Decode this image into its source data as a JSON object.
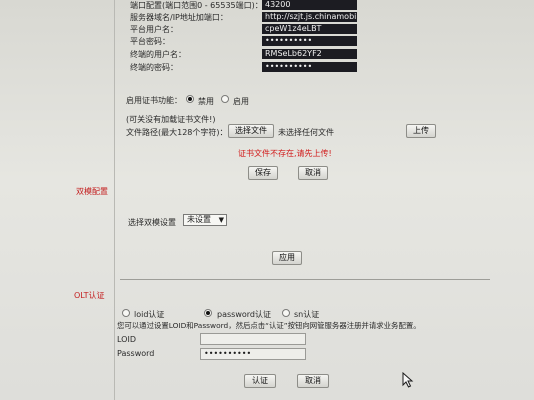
{
  "platform": {
    "rows": [
      {
        "label": "端口配置(端口范围0 - 65535端口)：",
        "value": "43200"
      },
      {
        "label": "服务器域名/IP地址加端口：",
        "value": "http://szjt.js.chinamobile."
      },
      {
        "label": "平台用户名：",
        "value": "cpeW1z4eLBT"
      },
      {
        "label": "平台密码：",
        "value": "••••••••••"
      },
      {
        "label": "终端的用户名：",
        "value": "RMSeLb62YF2"
      },
      {
        "label": "终端的密码：",
        "value": "••••••••••"
      }
    ]
  },
  "cert": {
    "enable_label": "启用证书功能：",
    "radio_disable": "禁用",
    "radio_enable": "启用",
    "note": "(可关没有加载证书文件!)",
    "path_label": "文件路径(最大128个字符)：",
    "choose_file": "选择文件",
    "no_file": "未选择任何文件",
    "upload": "上传",
    "error": "证书文件不存在,请先上传!",
    "save": "保存",
    "cancel": "取消"
  },
  "dual": {
    "title": "双模配置",
    "select_label": "选择双模设置",
    "select_value": "未设置",
    "apply": "应用"
  },
  "olt": {
    "title": "OLT认证",
    "radio_loid": "loid认证",
    "radio_password": "password认证",
    "radio_sn": "sn认证",
    "hint": "您可以通过设置LOID和Password，然后点击“认证”按钮向网管服务器注册并请求业务配置。",
    "loid_label": "LOID",
    "password_label": "Password",
    "password_value": "••••••••••",
    "confirm": "认证",
    "cancel": "取消"
  },
  "icons": {
    "dropdown": "chevron-down-icon",
    "cursor": "mouse-pointer-icon"
  },
  "colors": {
    "error": "#d11a1a",
    "section_title": "#c42020"
  }
}
